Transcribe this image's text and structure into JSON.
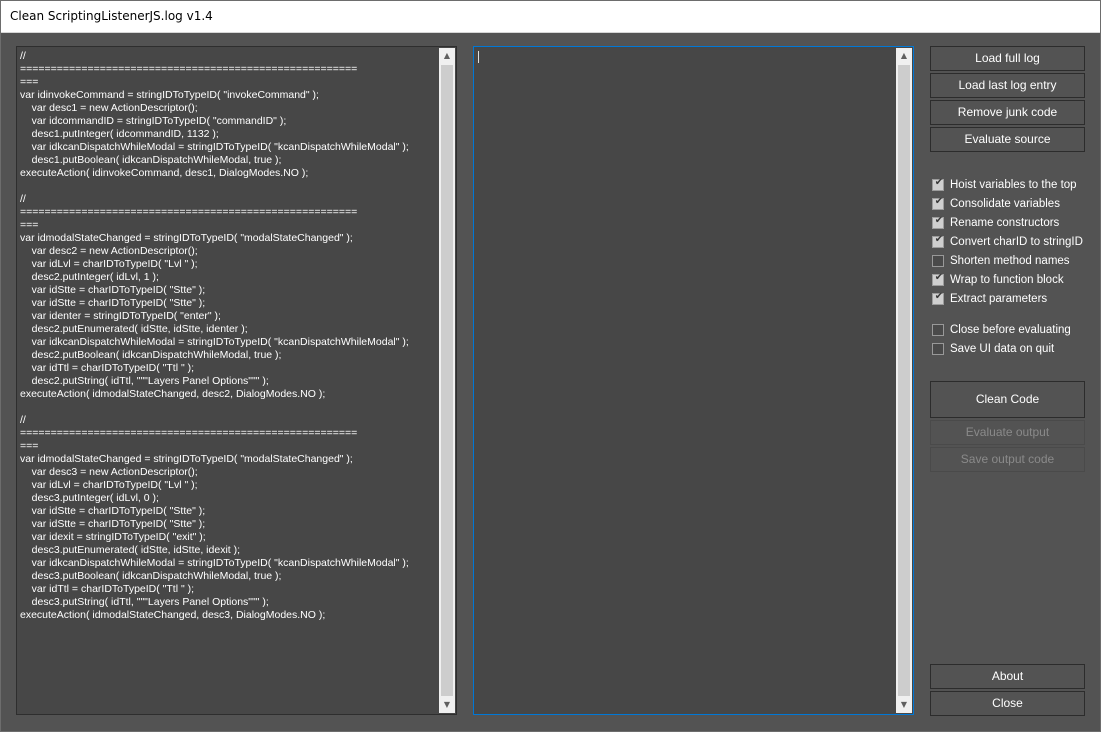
{
  "window": {
    "title": "Clean ScriptingListenerJS.log v1.4"
  },
  "source_panel": {
    "code": "//\n=======================================================\n===\nvar idinvokeCommand = stringIDToTypeID( \"invokeCommand\" );\n    var desc1 = new ActionDescriptor();\n    var idcommandID = stringIDToTypeID( \"commandID\" );\n    desc1.putInteger( idcommandID, 1132 );\n    var idkcanDispatchWhileModal = stringIDToTypeID( \"kcanDispatchWhileModal\" );\n    desc1.putBoolean( idkcanDispatchWhileModal, true );\nexecuteAction( idinvokeCommand, desc1, DialogModes.NO );\n\n//\n=======================================================\n===\nvar idmodalStateChanged = stringIDToTypeID( \"modalStateChanged\" );\n    var desc2 = new ActionDescriptor();\n    var idLvl = charIDToTypeID( \"Lvl \" );\n    desc2.putInteger( idLvl, 1 );\n    var idStte = charIDToTypeID( \"Stte\" );\n    var idStte = charIDToTypeID( \"Stte\" );\n    var identer = stringIDToTypeID( \"enter\" );\n    desc2.putEnumerated( idStte, idStte, identer );\n    var idkcanDispatchWhileModal = stringIDToTypeID( \"kcanDispatchWhileModal\" );\n    desc2.putBoolean( idkcanDispatchWhileModal, true );\n    var idTtl = charIDToTypeID( \"Ttl \" );\n    desc2.putString( idTtl, \"\"\"Layers Panel Options\"\"\" );\nexecuteAction( idmodalStateChanged, desc2, DialogModes.NO );\n\n//\n=======================================================\n===\nvar idmodalStateChanged = stringIDToTypeID( \"modalStateChanged\" );\n    var desc3 = new ActionDescriptor();\n    var idLvl = charIDToTypeID( \"Lvl \" );\n    desc3.putInteger( idLvl, 0 );\n    var idStte = charIDToTypeID( \"Stte\" );\n    var idStte = charIDToTypeID( \"Stte\" );\n    var idexit = stringIDToTypeID( \"exit\" );\n    desc3.putEnumerated( idStte, idStte, idexit );\n    var idkcanDispatchWhileModal = stringIDToTypeID( \"kcanDispatchWhileModal\" );\n    desc3.putBoolean( idkcanDispatchWhileModal, true );\n    var idTtl = charIDToTypeID( \"Ttl \" );\n    desc3.putString( idTtl, \"\"\"Layers Panel Options\"\"\" );\nexecuteAction( idmodalStateChanged, desc3, DialogModes.NO );"
  },
  "output_panel": {
    "value": ""
  },
  "buttons": {
    "load_full_log": "Load full log",
    "load_last_entry": "Load last log entry",
    "remove_junk": "Remove junk code",
    "evaluate_source": "Evaluate source",
    "clean_code": "Clean Code",
    "evaluate_output": "Evaluate output",
    "save_output": "Save output code",
    "about": "About",
    "close": "Close"
  },
  "options": [
    {
      "label": "Hoist variables to the top",
      "checked": true
    },
    {
      "label": "Consolidate variables",
      "checked": true
    },
    {
      "label": "Rename constructors",
      "checked": true
    },
    {
      "label": "Convert charID to stringID",
      "checked": true
    },
    {
      "label": "Shorten method names",
      "checked": false
    },
    {
      "label": "Wrap to function block",
      "checked": true
    },
    {
      "label": "Extract parameters",
      "checked": true
    }
  ],
  "settings": [
    {
      "label": "Close before evaluating",
      "checked": false
    },
    {
      "label": "Save UI data on quit",
      "checked": false
    }
  ],
  "icons": {
    "scroll_up": "scroll-up-arrow",
    "scroll_down": "scroll-down-arrow",
    "checkmark": "checkmark"
  }
}
